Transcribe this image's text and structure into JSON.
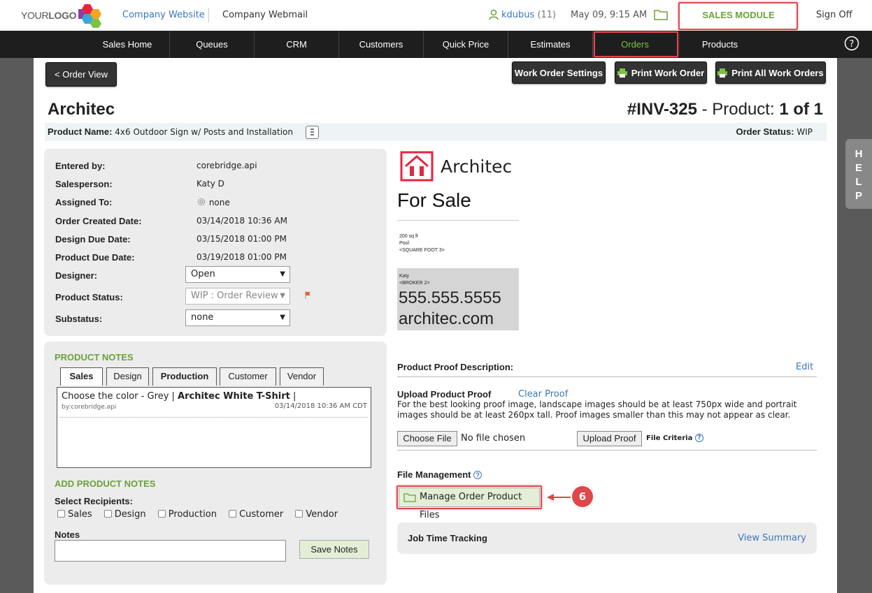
{
  "header": {
    "logo_text_light": "YOUR",
    "logo_text_bold": "LOGO",
    "company_website": "Company Website",
    "company_webmail": "Company Webmail",
    "username": "kdubus",
    "user_count": "(11)",
    "datetime": "May 09, 9:15 AM",
    "module": "SALES MODULE",
    "sign_off": "Sign Off"
  },
  "nav": {
    "items": [
      "Sales Home",
      "Queues",
      "CRM",
      "Customers",
      "Quick Price",
      "Estimates",
      "Orders",
      "Products"
    ],
    "active": "Orders"
  },
  "toolbar": {
    "order_view": "< Order View",
    "work_order_settings": "Work Order Settings",
    "print_work_order": "Print Work Order",
    "print_all": "Print All Work Orders"
  },
  "page": {
    "title": "Architec",
    "invoice": "#INV-325",
    "product_prefix": " - Product: ",
    "product_index": "1 of 1",
    "product_name_label": "Product Name:",
    "product_name": "4x6 Outdoor Sign w/ Posts and Installation",
    "order_status_label": "Order Status:",
    "order_status": "WIP"
  },
  "info": {
    "entered_by_label": "Entered by:",
    "entered_by": "corebridge.api",
    "salesperson_label": "Salesperson:",
    "salesperson": "Katy D",
    "assigned_to_label": "Assigned To:",
    "assigned_to": "none",
    "created_label": "Order Created Date:",
    "created": "03/14/2018 10:36 AM",
    "design_due_label": "Design Due Date:",
    "design_due": "03/15/2018 01:00 PM",
    "product_due_label": "Product Due Date:",
    "product_due": "03/19/2018 01:00 PM",
    "designer_label": "Designer:",
    "designer": "Open",
    "status_label": "Product Status:",
    "status": "WIP : Order Review",
    "substatus_label": "Substatus:",
    "substatus": "none"
  },
  "notes": {
    "title": "PRODUCT NOTES",
    "tabs": [
      "Sales",
      "Design",
      "Production",
      "Customer",
      "Vendor"
    ],
    "note_text": "Choose the color - Grey | ",
    "note_bold": "Architec White T-Shirt",
    "note_end": " |",
    "note_by": "by:corebridge.api",
    "note_date": "03/14/2018 10:36 AM CDT",
    "add_title": "ADD PRODUCT NOTES",
    "recipients_label": "Select Recipients:",
    "recipients": [
      "Sales",
      "Design",
      "Production",
      "Customer",
      "Vendor"
    ],
    "notes_label": "Notes",
    "save_notes": "Save Notes"
  },
  "proof": {
    "brand": "Architec",
    "headline": "For Sale",
    "small_lines": [
      "200 sq ft",
      "Pool",
      "<SQUARE FOOT 3>"
    ],
    "broker_lines": [
      "Katy",
      "<BROKER 2>"
    ],
    "phone": "555.555.5555",
    "website": "architec.com"
  },
  "right": {
    "proof_desc_label": "Product Proof Description:",
    "edit": "Edit",
    "upload_label": "Upload Product Proof",
    "clear_proof": "Clear Proof",
    "upload_help": "For the best looking proof image, landscape images should be at least 750px wide and portrait images should be at least 260px tall. Proof images smaller than this may not appear as clear.",
    "choose_file": "Choose File",
    "no_file": "No file chosen",
    "upload_proof": "Upload Proof",
    "file_criteria": "File Criteria",
    "file_mgmt": "File Management",
    "manage_files": "Manage Order Product Files",
    "callout": "6",
    "job_time": "Job Time Tracking",
    "view_summary": "View Summary"
  },
  "help_tab": [
    "H",
    "E",
    "L",
    "P"
  ],
  "colors": {
    "accent_green": "#6aa23a",
    "link_blue": "#3a77b8",
    "highlight_red": "#e0464b",
    "brand_red": "#e8233f"
  }
}
